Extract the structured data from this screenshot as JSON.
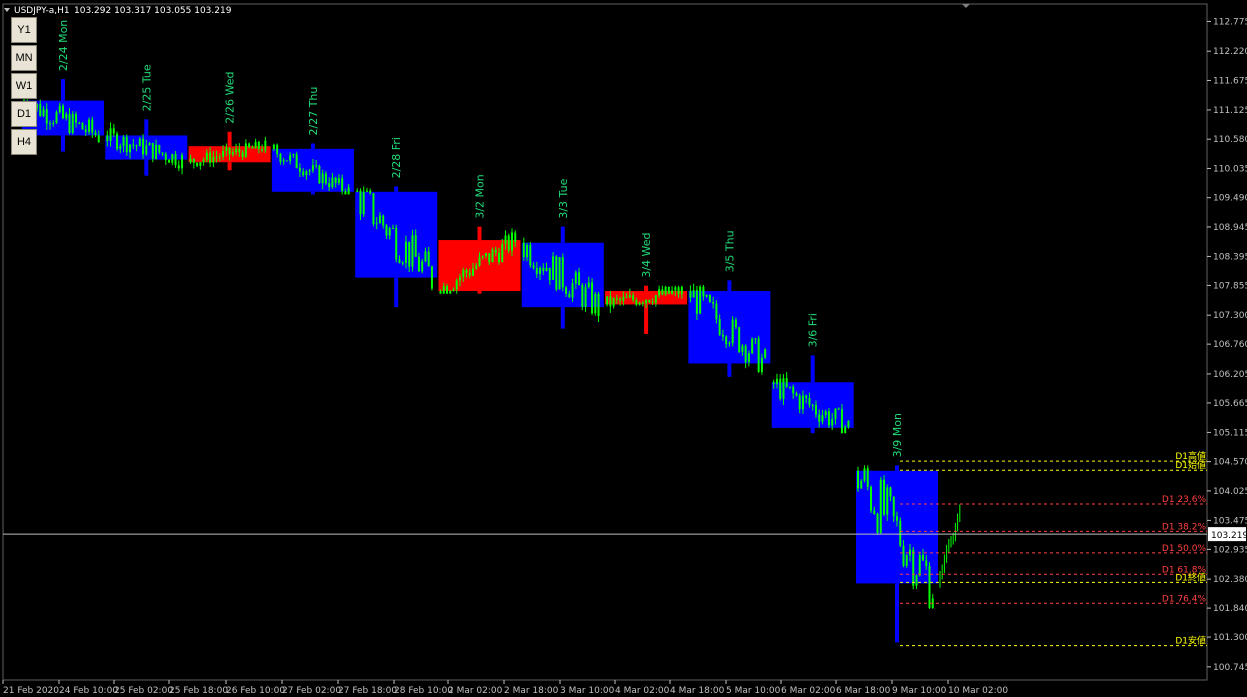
{
  "header": {
    "symbol": "USDJPY-a,H1",
    "ohlc": "103.292 103.317 103.055 103.219"
  },
  "timeframes": [
    "Y1",
    "MN",
    "W1",
    "D1",
    "H4"
  ],
  "price_axis": {
    "ticks": [
      "112.775",
      "112.220",
      "111.675",
      "111.125",
      "110.580",
      "110.035",
      "109.490",
      "108.945",
      "108.395",
      "107.855",
      "107.300",
      "106.760",
      "106.205",
      "105.665",
      "105.115",
      "104.570",
      "104.025",
      "103.475",
      "102.935",
      "102.380",
      "101.840",
      "101.300",
      "100.745"
    ],
    "current_price": "103.219"
  },
  "time_axis": [
    "21 Feb 2020",
    "24 Feb 10:00",
    "25 Feb 02:00",
    "25 Feb 18:00",
    "26 Feb 10:00",
    "27 Feb 02:00",
    "27 Feb 18:00",
    "28 Feb 10:00",
    "2 Mar 02:00",
    "2 Mar 18:00",
    "3 Mar 10:00",
    "4 Mar 02:00",
    "4 Mar 18:00",
    "5 Mar 10:00",
    "6 Mar 02:00",
    "6 Mar 18:00",
    "9 Mar 10:00",
    "10 Mar 02:00"
  ],
  "levels": {
    "high": "D1高値",
    "open": "D1始値",
    "fib236": "D1 23.6%",
    "fib382": "D1 38.2%",
    "fib500": "D1 50.0%",
    "fib618": "D1 61.8%",
    "close": "D1終値",
    "fib764": "D1 76.4%",
    "low": "D1安値"
  },
  "colors": {
    "background": "#000000",
    "bear_box": "#0000ff",
    "bull_box": "#ff0000",
    "candles": "#00ff00",
    "day_label": "#22dd77",
    "level_yellow": "#ffff00",
    "level_red": "#ff4040",
    "axis": "#c0c0c0"
  },
  "chart_data": {
    "type": "candlestick",
    "title": "USDJPY-a,H1",
    "ylim": [
      100.5,
      113.1
    ],
    "daily_boxes": [
      {
        "label": "2/24 Mon",
        "open": 111.3,
        "close": 110.65,
        "high": 111.7,
        "low": 110.35,
        "direction": "down"
      },
      {
        "label": "2/25 Tue",
        "open": 110.65,
        "close": 110.2,
        "high": 110.95,
        "low": 109.9,
        "direction": "down"
      },
      {
        "label": "2/26 Wed",
        "open": 110.15,
        "close": 110.45,
        "high": 110.72,
        "low": 110.0,
        "direction": "up"
      },
      {
        "label": "2/27 Thu",
        "open": 110.4,
        "close": 109.6,
        "high": 110.5,
        "low": 109.55,
        "direction": "down"
      },
      {
        "label": "2/28 Fri",
        "open": 109.6,
        "close": 108.0,
        "high": 109.7,
        "low": 107.45,
        "direction": "down"
      },
      {
        "label": "3/2 Mon",
        "open": 107.75,
        "close": 108.7,
        "high": 108.95,
        "low": 107.7,
        "direction": "up"
      },
      {
        "label": "3/3 Tue",
        "open": 108.65,
        "close": 107.45,
        "high": 108.95,
        "low": 107.05,
        "direction": "down"
      },
      {
        "label": "3/4 Wed",
        "open": 107.5,
        "close": 107.75,
        "high": 107.85,
        "low": 106.95,
        "direction": "up"
      },
      {
        "label": "3/5 Thu",
        "open": 107.75,
        "close": 106.4,
        "high": 107.95,
        "low": 106.15,
        "direction": "down"
      },
      {
        "label": "3/6 Fri",
        "open": 106.05,
        "close": 105.2,
        "high": 106.55,
        "low": 105.1,
        "direction": "down"
      },
      {
        "label": "3/9 Mon",
        "open": 104.4,
        "close": 102.3,
        "high": 104.5,
        "low": 101.2,
        "direction": "down"
      }
    ],
    "levels_d1": {
      "high": 104.58,
      "open": 104.41,
      "fib236": 103.78,
      "fib382": 103.27,
      "fib500": 102.87,
      "fib618": 102.47,
      "close": 102.32,
      "fib764": 101.93,
      "low": 101.14
    }
  }
}
